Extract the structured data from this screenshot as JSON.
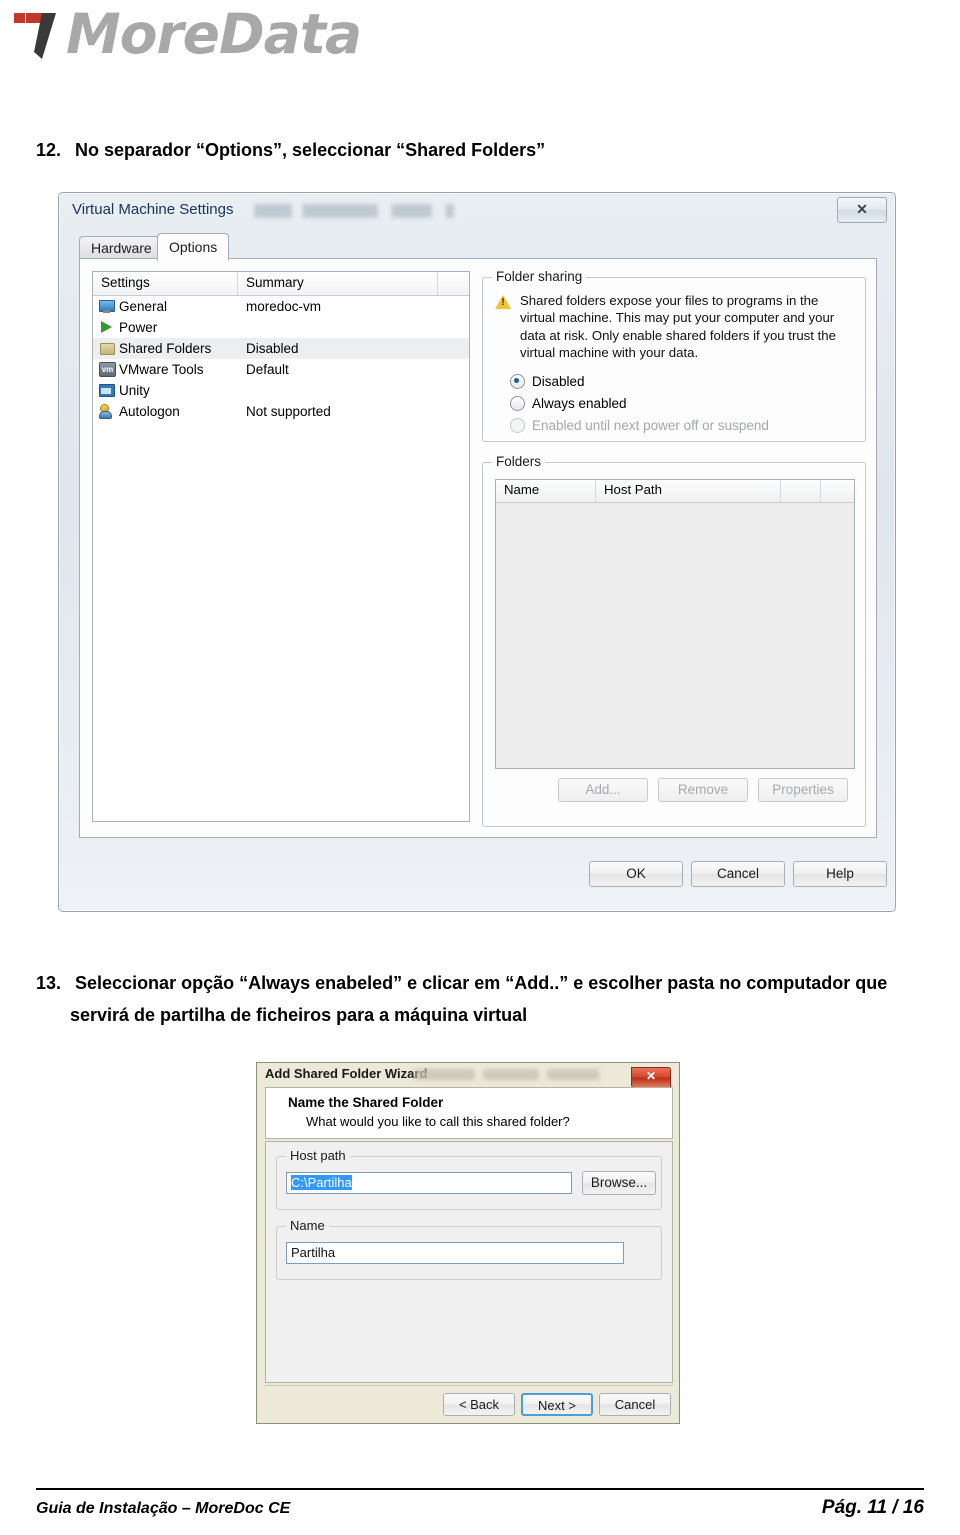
{
  "document": {
    "logo_text": "MoreData",
    "logo_mark": "moredata-logo-mark",
    "footer_left": "Guia de Instalação – MoreDoc CE",
    "footer_right": "Pág. 11 / 16"
  },
  "steps": {
    "step12": {
      "number": "12.",
      "text": "No separador “Options”, seleccionar  “Shared Folders”"
    },
    "step13": {
      "number": "13.",
      "line1": "Seleccionar opção “Always enabeled” e clicar em “Add..” e escolher pasta no computador que",
      "line2": "servirá de partilha de ficheiros para a máquina virtual"
    }
  },
  "vm_settings_dialog": {
    "title": "Virtual Machine Settings",
    "close_label": "✕",
    "tabs": [
      {
        "label": "Hardware",
        "active": false
      },
      {
        "label": "Options",
        "active": true
      }
    ],
    "settings_table": {
      "headers": [
        "Settings",
        "Summary"
      ],
      "rows": [
        {
          "icon": "monitor-icon",
          "name": "General",
          "summary": "moredoc-vm",
          "selected": false
        },
        {
          "icon": "play-icon",
          "name": "Power",
          "summary": "",
          "selected": false
        },
        {
          "icon": "folder-icon",
          "name": "Shared Folders",
          "summary": "Disabled",
          "selected": true
        },
        {
          "icon": "vmware-tools-icon",
          "name": "VMware Tools",
          "summary": "Default",
          "selected": false
        },
        {
          "icon": "unity-window-icon",
          "name": "Unity",
          "summary": "",
          "selected": false
        },
        {
          "icon": "autologon-user-icon",
          "name": "Autologon",
          "summary": "Not supported",
          "selected": false
        }
      ]
    },
    "folder_sharing": {
      "legend": "Folder sharing",
      "warning": "Shared folders expose your files to programs in the virtual machine. This may put your computer and your data at risk. Only enable shared folders if you trust the virtual machine with your data.",
      "options": [
        {
          "label": "Disabled",
          "selected": true,
          "enabled": true
        },
        {
          "label": "Always enabled",
          "selected": false,
          "enabled": true
        },
        {
          "label": "Enabled until next power off or suspend",
          "selected": false,
          "enabled": false
        }
      ]
    },
    "folders": {
      "legend": "Folders",
      "headers": [
        "Name",
        "Host Path"
      ],
      "rows": [],
      "buttons": [
        {
          "label": "Add...",
          "enabled": false
        },
        {
          "label": "Remove",
          "enabled": false
        },
        {
          "label": "Properties",
          "enabled": false
        }
      ]
    },
    "footer_buttons": [
      {
        "label": "OK"
      },
      {
        "label": "Cancel"
      },
      {
        "label": "Help"
      }
    ]
  },
  "wizard_dialog": {
    "title": "Add Shared Folder Wizard",
    "close_label": "✕",
    "heading": "Name the Shared Folder",
    "subheading": "What would you like to call this shared folder?",
    "host_path": {
      "legend": "Host path",
      "value": "C:\\Partilha",
      "selected": true,
      "browse_label": "Browse..."
    },
    "name": {
      "legend": "Name",
      "value": "Partilha"
    },
    "buttons": [
      {
        "label": "< Back",
        "default": false
      },
      {
        "label": "Next >",
        "default": true
      },
      {
        "label": "Cancel",
        "default": false
      }
    ]
  },
  "colors": {
    "logo_gray": "#a8a8a8",
    "logo_red": "#c0392b",
    "logo_dark": "#3a3a3a",
    "selection_blue": "#3399ff",
    "default_button_border": "#4d9ed6",
    "warning_yellow": "#f2c335"
  }
}
